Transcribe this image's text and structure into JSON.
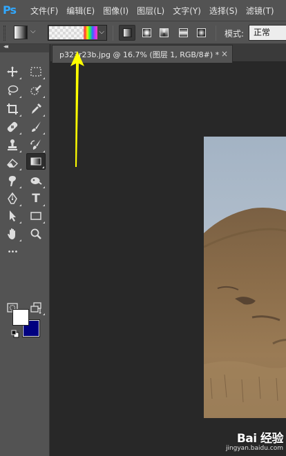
{
  "app": {
    "logo_text": "Ps"
  },
  "menu": [
    "文件(F)",
    "编辑(E)",
    "图像(I)",
    "图层(L)",
    "文字(Y)",
    "选择(S)",
    "滤镜(T)"
  ],
  "options_bar": {
    "mode_label": "模式:",
    "mode_value": "正常",
    "gradient_types": [
      "linear",
      "radial",
      "angle",
      "reflected",
      "diamond"
    ],
    "active_gradient_type": "linear"
  },
  "document": {
    "tab_title": "p323r23b.jpg @ 16.7% (图层 1, RGB/8#) *",
    "close_symbol": "×"
  },
  "toolbox": {
    "collapse_symbol": "◂◂",
    "tools": [
      "move-icon",
      "marquee-icon",
      "lasso-icon",
      "quick-select-icon",
      "crop-icon",
      "eyedropper-icon",
      "healing-icon",
      "brush-icon",
      "stamp-icon",
      "history-brush-icon",
      "eraser-icon",
      "gradient-icon",
      "smudge-icon",
      "dodge-icon",
      "pen-icon",
      "type-icon",
      "path-select-icon",
      "rectangle-icon",
      "hand-icon",
      "zoom-icon",
      "more-tools-icon",
      "quick-mask-icon",
      "screen-mode-icon"
    ],
    "selected_tool": "gradient-icon",
    "type_tool_glyph": "T",
    "more_glyph": "•••"
  },
  "colors": {
    "foreground": "#ffffff",
    "background": "#000080",
    "arrow_annotation": "#ffff00"
  },
  "watermark": {
    "logo": "Bai 经验",
    "url": "jingyan.baidu.com"
  }
}
